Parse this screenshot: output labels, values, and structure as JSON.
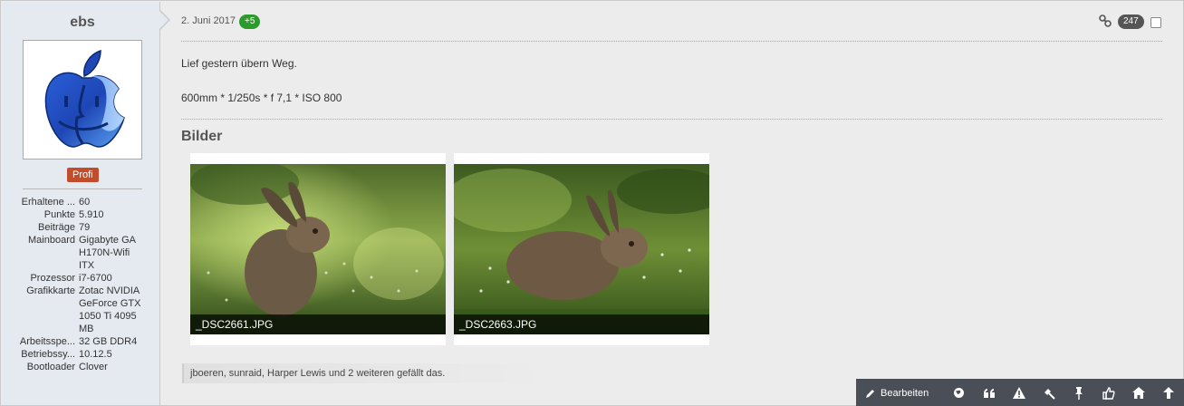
{
  "user": {
    "name": "ebs",
    "rank": "Profi",
    "stats": [
      {
        "label": "Erhaltene ...",
        "value": "60"
      },
      {
        "label": "Punkte",
        "value": "5.910"
      },
      {
        "label": "Beiträge",
        "value": "79"
      },
      {
        "label": "Mainboard",
        "value": "Gigabyte GA H170N-Wifi ITX"
      },
      {
        "label": "Prozessor",
        "value": "i7-6700"
      },
      {
        "label": "Grafikkarte",
        "value": "Zotac NVIDIA GeForce GTX 1050 Ti 4095 MB"
      },
      {
        "label": "Arbeitsspe...",
        "value": "32 GB DDR4"
      },
      {
        "label": "Betriebssy...",
        "value": "10.12.5"
      },
      {
        "label": "Bootloader",
        "value": "Clover"
      }
    ]
  },
  "post": {
    "date": "2. Juni 2017",
    "likes_badge": "+5",
    "post_number": "247",
    "text_line1": "Lief gestern übern Weg.",
    "text_line2": "600mm * 1/250s * f 7,1 * ISO 800",
    "section_title": "Bilder",
    "images": [
      {
        "caption": "_DSC2661.JPG"
      },
      {
        "caption": "_DSC2663.JPG"
      }
    ],
    "liked_by": "jboeren, sunraid, Harper Lewis und 2 weiteren gefällt das."
  },
  "toolbar": {
    "edit_label": "Bearbeiten",
    "icons": [
      "globe-icon",
      "quote-icon",
      "warning-icon",
      "gavel-icon",
      "pin-icon",
      "thumbs-up-icon",
      "home-icon",
      "arrow-up-icon"
    ]
  },
  "colors": {
    "sidebar_bg": "#e4eaf0",
    "rank_badge": "#c14d2c",
    "likes_badge": "#2d9a2d",
    "toolbar_bg": "#4a4f57"
  }
}
